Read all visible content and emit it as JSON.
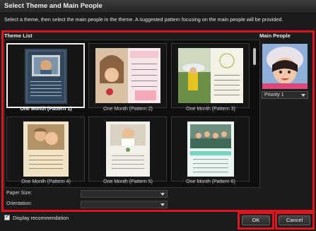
{
  "dialog": {
    "title": "Select Theme and Main People",
    "instruction": "Select a theme, then select the main people in the theme. A suggested pattern focusing on the main people will be provided."
  },
  "theme_list": {
    "label": "Theme List",
    "items": [
      {
        "caption": "One Month (Pattern 1)",
        "selected": true
      },
      {
        "caption": "One Month (Pattern 2)",
        "selected": false
      },
      {
        "caption": "One Month (Pattern 3)",
        "selected": false
      },
      {
        "caption": "One Month (Pattern 4)",
        "selected": false
      },
      {
        "caption": "One Month (Pattern 5)",
        "selected": false
      },
      {
        "caption": "One Month (Pattern 6)",
        "selected": false
      }
    ]
  },
  "fields": {
    "paper_size_label": "Paper Size:",
    "orientation_label": "Orientation:"
  },
  "main_people": {
    "label": "Main People",
    "priority_value": "Priority 1"
  },
  "footer": {
    "display_recommendation_label": "Display recommendation",
    "display_recommendation_checked": true,
    "ok_label": "OK",
    "cancel_label": "Cancel"
  },
  "colors": {
    "highlight_frame": "#e0141e",
    "background": "#1b1b1b"
  }
}
